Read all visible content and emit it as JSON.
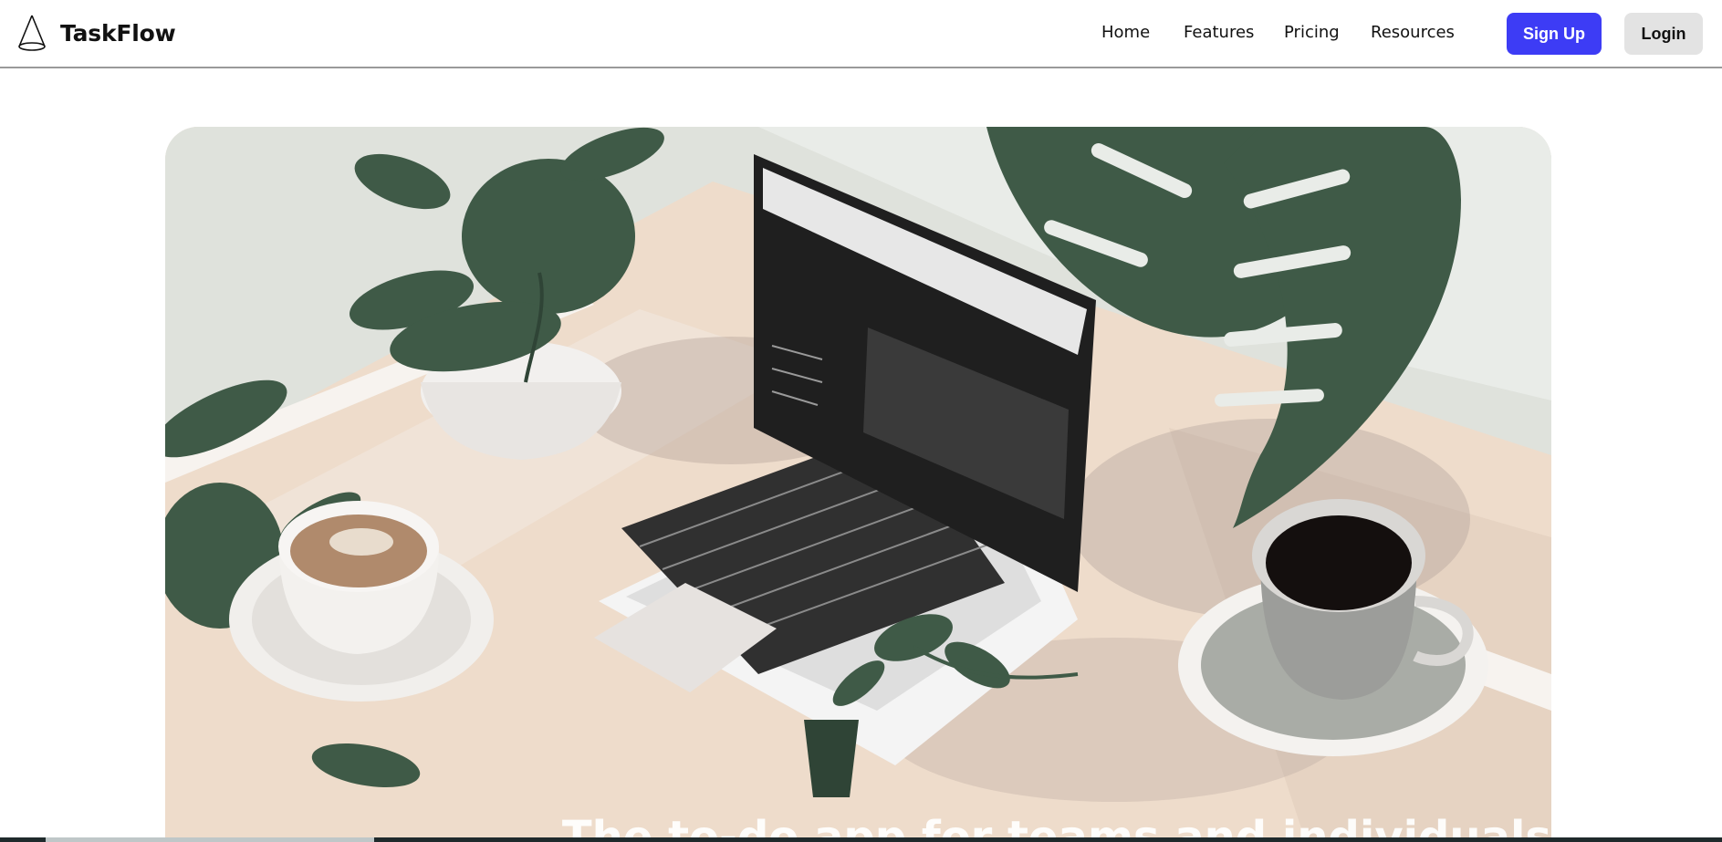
{
  "brand": {
    "name": "TaskFlow",
    "logo_icon": "cone-icon"
  },
  "nav": {
    "links": [
      "Home",
      "Features",
      "Pricing",
      "Resources"
    ]
  },
  "actions": {
    "signup_label": "Sign Up",
    "login_label": "Login"
  },
  "hero": {
    "image": "workspace-illustration",
    "heading": "The to-do app for teams and individuals"
  },
  "colors": {
    "accent": "#3d3cf5",
    "login_bg": "#e3e3e3",
    "hero_bg": "#eadccd",
    "plant_green": "#3f5a47"
  }
}
